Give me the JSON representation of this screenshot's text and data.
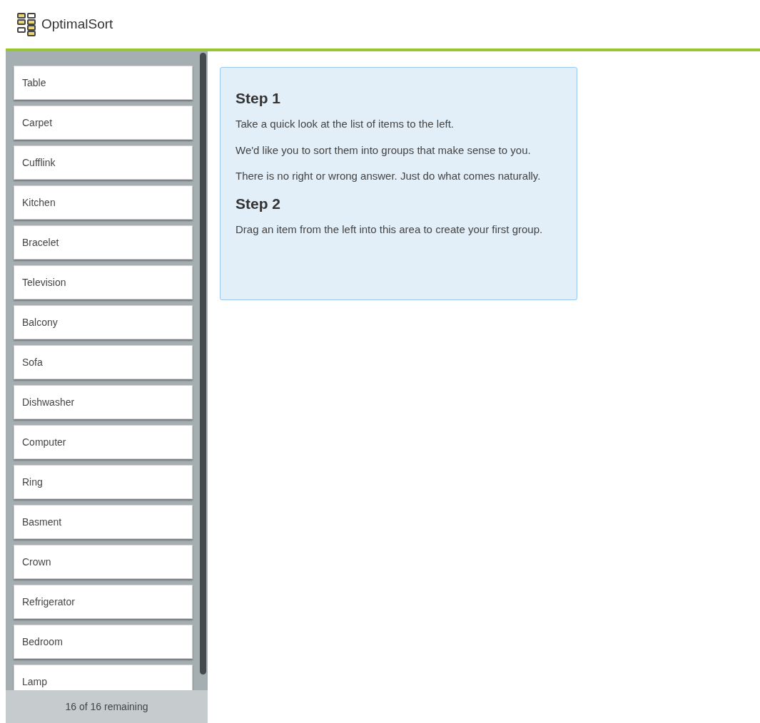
{
  "header": {
    "app_name": "OptimalSort"
  },
  "cards": {
    "items": [
      "Table",
      "Carpet",
      "Cufflink",
      "Kitchen",
      "Bracelet",
      "Television",
      "Balcony",
      "Sofa",
      "Dishwasher",
      "Computer",
      "Ring",
      "Basment",
      "Crown",
      "Refrigerator",
      "Bedroom",
      "Lamp"
    ],
    "remaining": "16 of 16 remaining"
  },
  "instructions": [
    {
      "kind": "heading",
      "text": "Step 1"
    },
    {
      "kind": "paragraph",
      "text": "Take a quick look at the list of items to the left."
    },
    {
      "kind": "paragraph",
      "text": "We'd like you to sort them into groups that make sense to you."
    },
    {
      "kind": "paragraph",
      "text": "There is no right or wrong answer. Just do what comes naturally."
    },
    {
      "kind": "heading",
      "text": "Step 2"
    },
    {
      "kind": "paragraph",
      "text": "Drag an item from the left into this area to create your first group."
    }
  ]
}
